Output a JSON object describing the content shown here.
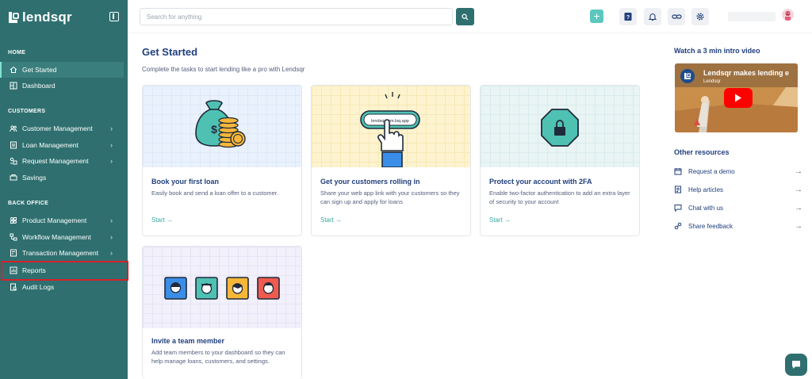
{
  "app": {
    "logo_text": "lendsqr"
  },
  "sidebar": {
    "sections": {
      "home": "HOME",
      "customers": "CUSTOMERS",
      "back_office": "BACK OFFICE"
    },
    "items": [
      {
        "label": "Get Started",
        "icon": "home-icon",
        "active": true
      },
      {
        "label": "Dashboard",
        "icon": "dashboard-icon"
      },
      {
        "label": "Customer Management",
        "icon": "users-icon",
        "chevron": true
      },
      {
        "label": "Loan Management",
        "icon": "loan-icon",
        "chevron": true
      },
      {
        "label": "Request Management",
        "icon": "request-icon",
        "chevron": true
      },
      {
        "label": "Savings",
        "icon": "savings-icon"
      },
      {
        "label": "Product Management",
        "icon": "product-icon",
        "chevron": true
      },
      {
        "label": "Workflow Management",
        "icon": "workflow-icon",
        "chevron": true
      },
      {
        "label": "Transaction Management",
        "icon": "transaction-icon",
        "chevron": true
      },
      {
        "label": "Reports",
        "icon": "reports-icon",
        "highlighted": true
      },
      {
        "label": "Audit Logs",
        "icon": "audit-icon"
      }
    ]
  },
  "topbar": {
    "search_placeholder": "Search for anything",
    "plus_label": "+"
  },
  "main": {
    "title": "Get Started",
    "subtitle": "Complete the tasks to start lending like a pro with Lendsqr",
    "cards": [
      {
        "title": "Book your first loan",
        "desc": "Easily book and send a loan offer to a customer.",
        "cta": "Start →"
      },
      {
        "title": "Get your customers rolling in",
        "desc": "Share your web app link with your customers so they can sign up and apply for loans",
        "cta": "Start →",
        "art_link": "lendsqrcom.lsq.app"
      },
      {
        "title": "Protect your account with 2FA",
        "desc": "Enable two-factor authentication to add an extra layer of security to your account",
        "cta": "Start →"
      },
      {
        "title": "Invite a team member",
        "desc": "Add team members to your dashboard so they can help manage loans, customers, and settings."
      }
    ]
  },
  "right": {
    "video_heading": "Watch a 3 min intro video",
    "video_title": "Lendsqr makes lending e",
    "video_channel": "Lendsqr",
    "other_heading": "Other resources",
    "resources": [
      {
        "label": "Request a demo",
        "icon": "calendar-icon"
      },
      {
        "label": "Help articles",
        "icon": "article-icon"
      },
      {
        "label": "Chat with us",
        "icon": "chat-icon"
      },
      {
        "label": "Share feedback",
        "icon": "feedback-icon"
      }
    ]
  },
  "colors": {
    "sidebar": "#2f6f6f",
    "accent": "#39a8a0",
    "highlight": "#d9202a",
    "title": "#213f7d"
  }
}
